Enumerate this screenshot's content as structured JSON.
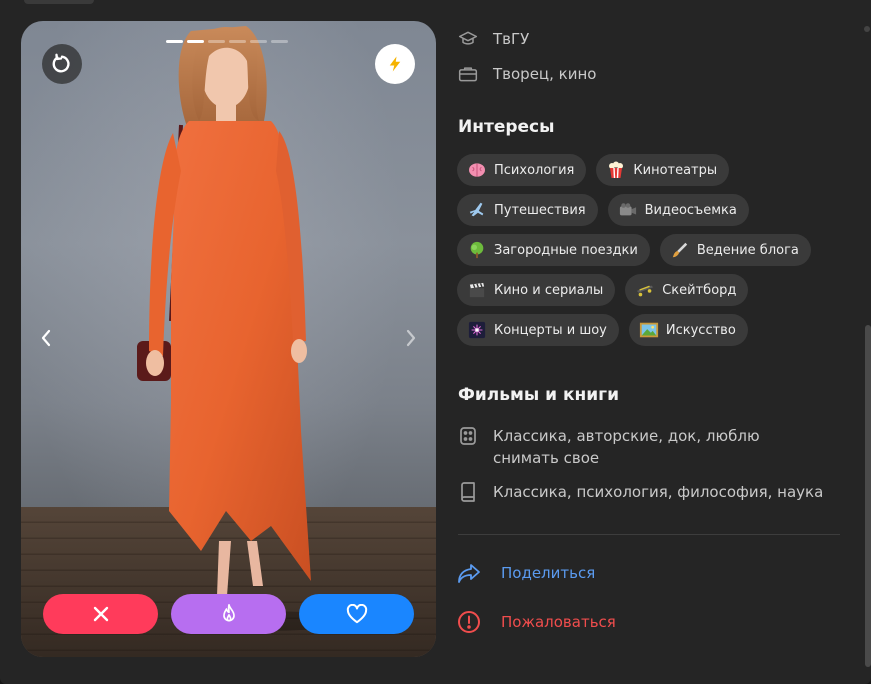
{
  "profile": {
    "education": "ТвГУ",
    "job": "Творец, кино"
  },
  "photo": {
    "count": 6,
    "active_index": 1
  },
  "interests": {
    "title": "Интересы",
    "rows": [
      [
        {
          "label": "Психология",
          "icon": "brain-icon"
        },
        {
          "label": "Кинотеатры",
          "icon": "popcorn-icon"
        }
      ],
      [
        {
          "label": "Путешествия",
          "icon": "airplane-icon"
        },
        {
          "label": "Видеосъемка",
          "icon": "video-camera-icon"
        }
      ],
      [
        {
          "label": "Загородные поездки",
          "icon": "tree-icon"
        },
        {
          "label": "Ведение блога",
          "icon": "brush-icon"
        }
      ],
      [
        {
          "label": "Кино и сериалы",
          "icon": "clapperboard-icon"
        },
        {
          "label": "Скейтборд",
          "icon": "skateboard-icon"
        }
      ],
      [
        {
          "label": "Концерты и шоу",
          "icon": "fireworks-icon"
        },
        {
          "label": "Искусство",
          "icon": "picture-icon"
        }
      ]
    ]
  },
  "media": {
    "title": "Фильмы и книги",
    "films": "Классика, авторские, док, люблю снимать свое",
    "books": "Классика, психология, философия, наука"
  },
  "actions": {
    "share": "Поделиться",
    "report": "Пожаловаться"
  },
  "colors": {
    "dislike": "#ff3b5b",
    "superlike": "#b76ef0",
    "like": "#1a86ff",
    "boost": "#f5b300",
    "share": "#5b9bf0",
    "report": "#f04d4d"
  }
}
